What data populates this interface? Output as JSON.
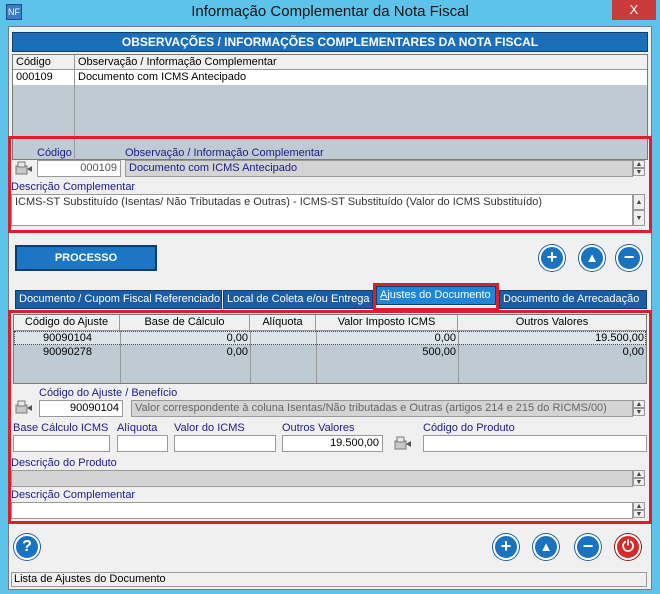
{
  "window": {
    "title": "Informação Complementar da Nota Fiscal",
    "close_glyph": "X",
    "app_icon": "NF"
  },
  "header_bar": "OBSERVAÇÕES / INFORMAÇÕES COMPLEMENTARES DA NOTA FISCAL",
  "obs_grid": {
    "columns": [
      "Código",
      "Observação / Informação Complementar"
    ],
    "rows": [
      {
        "codigo": "000109",
        "obs": "Documento com ICMS Antecipado"
      }
    ]
  },
  "obs_form": {
    "codigo_label": "Código",
    "codigo_value": "000109",
    "obs_label": "Observação / Informação Complementar",
    "obs_value": "Documento com ICMS Antecipado",
    "desc_label": "Descrição Complementar",
    "desc_value": "ICMS-ST Substituído (Isentas/ Não Tributadas e Outras) - ICMS-ST Substituído (Valor do ICMS Substituído)"
  },
  "buttons": {
    "processo": "PROCESSO",
    "add": "+",
    "up": "▲",
    "remove": "−",
    "help": "?",
    "power": "⏻"
  },
  "tabs": [
    {
      "label": "Documento / Cupom Fiscal Referenciado",
      "mnemonic": ""
    },
    {
      "label": "Local de Coleta e/ou Entrega",
      "mnemonic": ""
    },
    {
      "label": "Ajustes do Documento",
      "mnemonic": "A"
    },
    {
      "label": "Documento de Arrecadação",
      "mnemonic": ""
    }
  ],
  "ajustes_grid": {
    "columns": [
      "Código do Ajuste",
      "Base de Cálculo",
      "Alíquota",
      "Valor Imposto ICMS",
      "Outros Valores"
    ],
    "rows": [
      {
        "codigo": "90090104",
        "base": "0,00",
        "aliquota": "",
        "valor": "0,00",
        "outros": "19.500,00"
      },
      {
        "codigo": "90090278",
        "base": "0,00",
        "aliquota": "",
        "valor": "500,00",
        "outros": "0,00"
      }
    ]
  },
  "ajuste_form": {
    "codigo_label": "Código do Ajuste / Benefício",
    "codigo_value": "90090104",
    "codigo_desc": "Valor correspondente à coluna Isentas/Não tributadas e Outras (artigos 214 e 215 do RICMS/00)",
    "base_label": "Base Cálculo ICMS",
    "aliquota_label": "Alíquota",
    "valor_label": "Valor do ICMS",
    "outros_label": "Outros Valores",
    "outros_value": "19.500,00",
    "produto_label": "Código do Produto",
    "desc_produto_label": "Descrição do Produto",
    "desc_compl_label": "Descrição Complementar"
  },
  "status": "Lista de Ajustes do Documento",
  "colors": {
    "accent": "#1a6fb8",
    "highlight": "#e01d2a",
    "title_bg": "#5dc3ea"
  }
}
